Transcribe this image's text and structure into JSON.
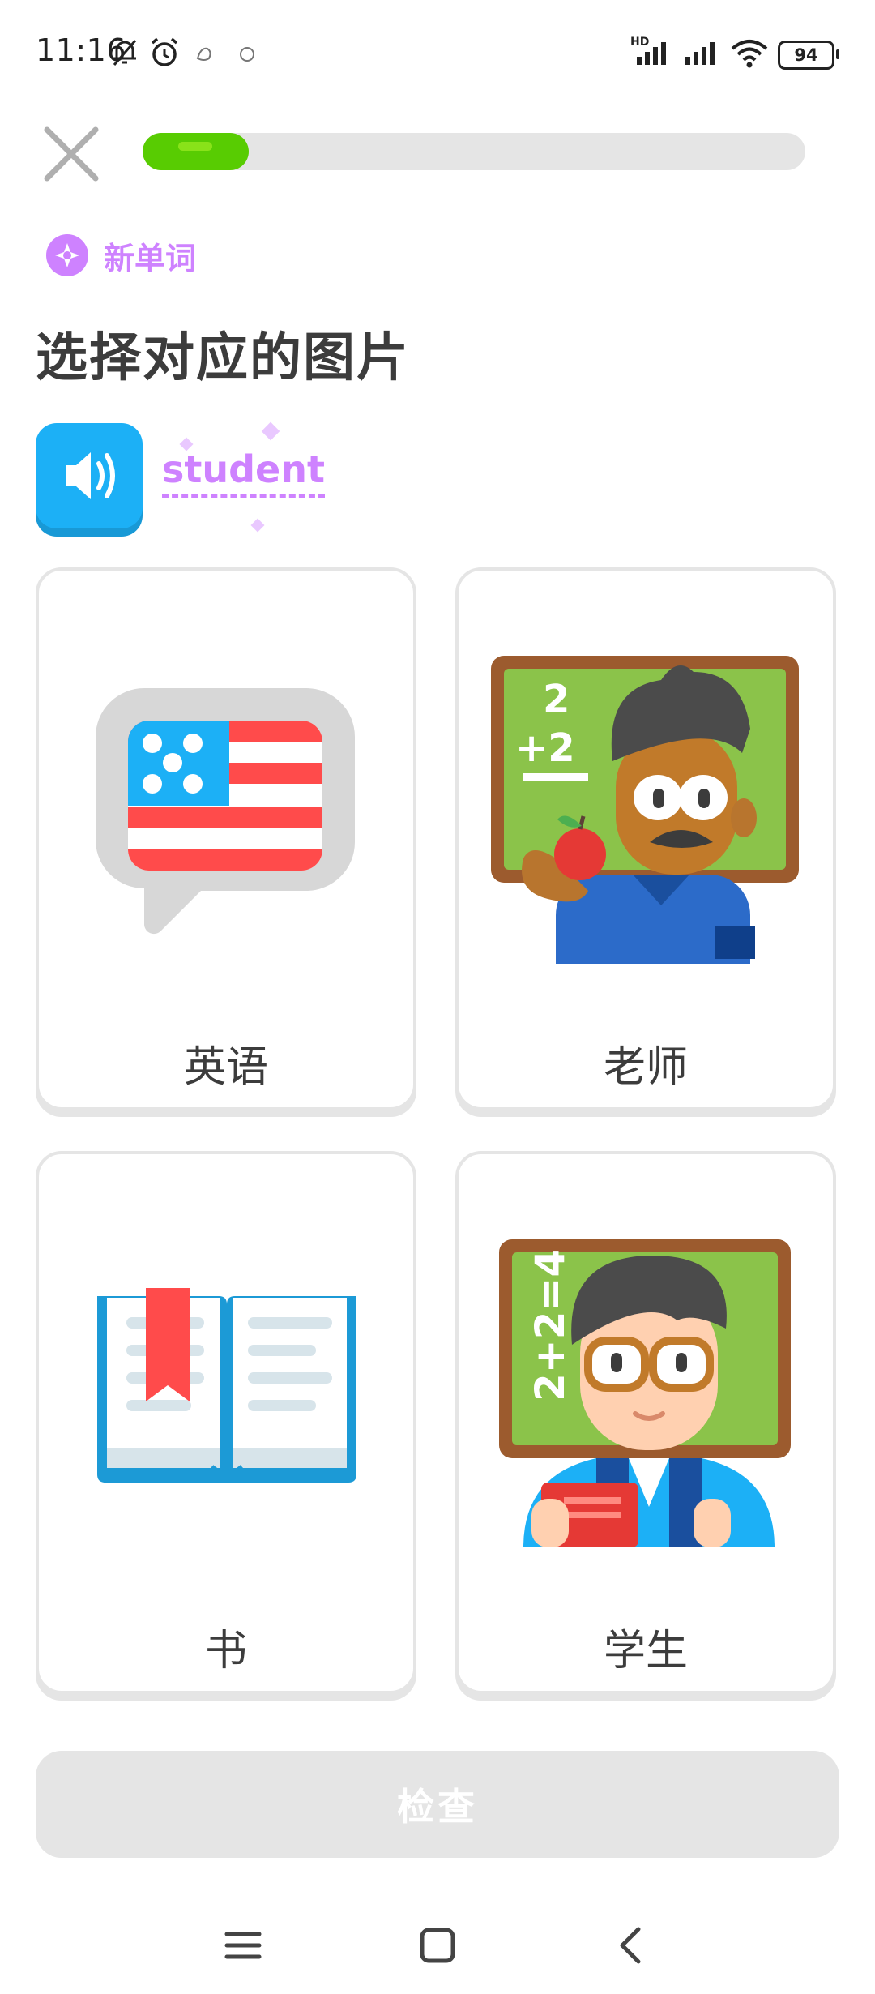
{
  "status_bar": {
    "time": "11:16",
    "battery": "94",
    "network": "HD"
  },
  "header": {
    "progress_fraction": 0.16
  },
  "lesson": {
    "badge_label": "新单词",
    "title": "选择对应的图片",
    "prompt_word": "student"
  },
  "options": [
    {
      "label": "英语",
      "icon": "us-flag-speech-bubble-icon"
    },
    {
      "label": "老师",
      "icon": "teacher-illustration"
    },
    {
      "label": "书",
      "icon": "open-book-icon"
    },
    {
      "label": "学生",
      "icon": "student-illustration"
    }
  ],
  "actions": {
    "check_label": "检查"
  },
  "colors": {
    "accent_green": "#58cc02",
    "accent_purple": "#ce82ff",
    "accent_blue": "#1cb0f6",
    "disabled_gray": "#e5e5e5"
  }
}
